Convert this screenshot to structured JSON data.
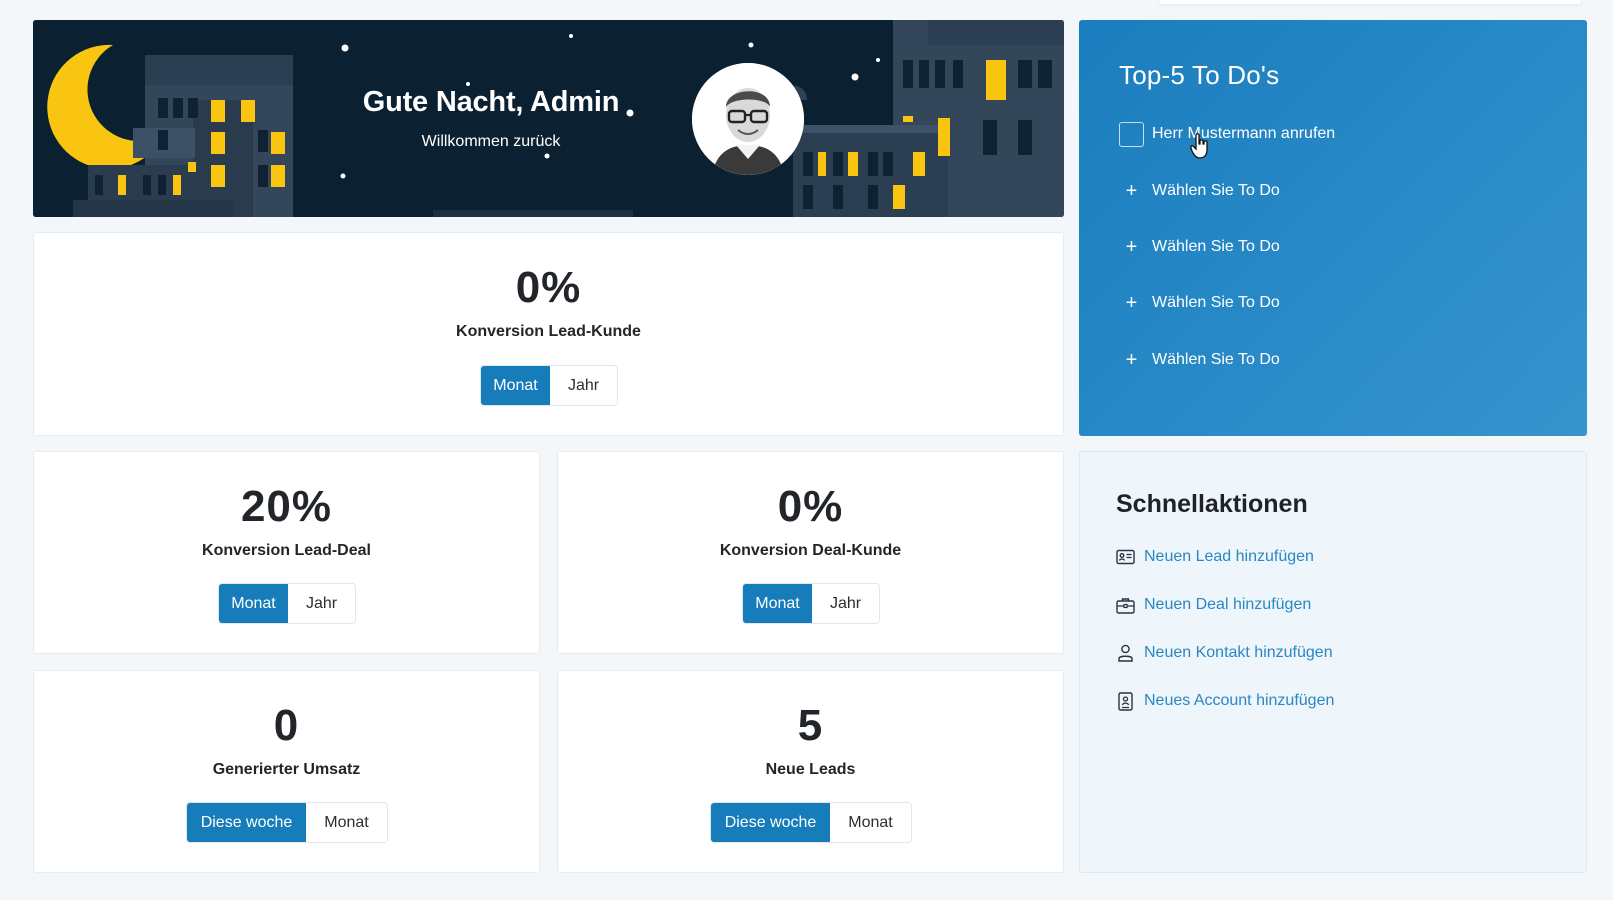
{
  "colors": {
    "accent": "#167dba",
    "banner_bg": "#0b2131",
    "window_yellow": "#f9c510",
    "todo_panel": "#2a8bc8",
    "quick_link": "#2b86c2"
  },
  "banner": {
    "greeting": "Gute Nacht, Admin",
    "subtitle": "Willkommen zurück",
    "avatar_icon": "user-avatar"
  },
  "kpis": {
    "lead_kunde": {
      "value": "0%",
      "label": "Konversion Lead-Kunde",
      "options": [
        "Monat",
        "Jahr"
      ],
      "active": "Monat"
    },
    "lead_deal": {
      "value": "20%",
      "label": "Konversion Lead-Deal",
      "options": [
        "Monat",
        "Jahr"
      ],
      "active": "Monat"
    },
    "deal_kunde": {
      "value": "0%",
      "label": "Konversion Deal-Kunde",
      "options": [
        "Monat",
        "Jahr"
      ],
      "active": "Monat"
    },
    "umsatz": {
      "value": "0",
      "label": "Generierter Umsatz",
      "options": [
        "Diese woche",
        "Monat"
      ],
      "active": "Diese woche"
    },
    "neue_leads": {
      "value": "5",
      "label": "Neue Leads",
      "options": [
        "Diese woche",
        "Monat"
      ],
      "active": "Diese woche"
    }
  },
  "todos": {
    "title": "Top-5 To Do's",
    "items": [
      {
        "label": "Herr Mustermann anrufen",
        "type": "checkbox",
        "checked": false
      },
      {
        "label": "Wählen Sie To Do",
        "type": "add"
      },
      {
        "label": "Wählen Sie To Do",
        "type": "add"
      },
      {
        "label": "Wählen Sie To Do",
        "type": "add"
      },
      {
        "label": "Wählen Sie To Do",
        "type": "add"
      }
    ]
  },
  "quick_actions": {
    "title": "Schnellaktionen",
    "items": [
      {
        "label": "Neuen Lead hinzufügen",
        "icon": "id-card-icon"
      },
      {
        "label": "Neuen Deal hinzufügen",
        "icon": "briefcase-icon"
      },
      {
        "label": "Neuen Kontakt hinzufügen",
        "icon": "person-icon"
      },
      {
        "label": "Neues Account hinzufügen",
        "icon": "contact-book-icon"
      }
    ]
  }
}
